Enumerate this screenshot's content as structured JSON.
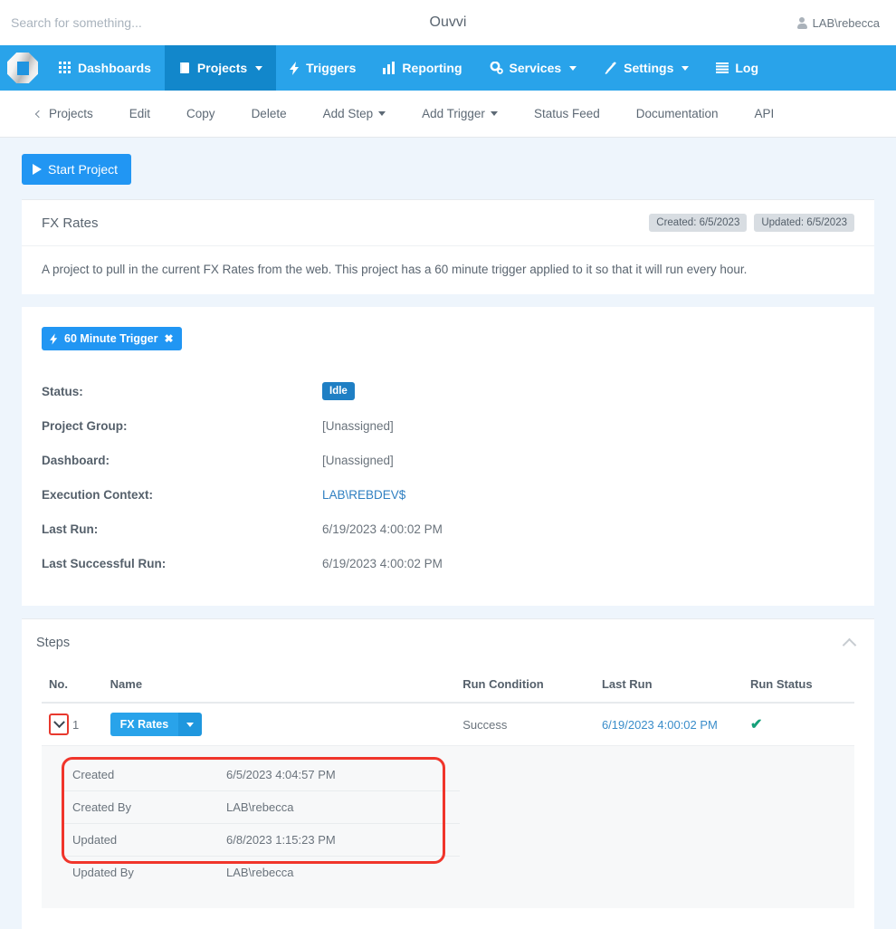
{
  "topbar": {
    "search_placeholder": "Search for something...",
    "search_value": "",
    "app_title": "Ouvvi",
    "user": "LAB\\rebecca"
  },
  "mainnav": {
    "items": [
      {
        "label": "Dashboards",
        "icon": "grid-icon",
        "caret": false,
        "active": false
      },
      {
        "label": "Projects",
        "icon": "book-icon",
        "caret": true,
        "active": true
      },
      {
        "label": "Triggers",
        "icon": "bolt-icon",
        "caret": false,
        "active": false
      },
      {
        "label": "Reporting",
        "icon": "bar-chart-icon",
        "caret": false,
        "active": false
      },
      {
        "label": "Services",
        "icon": "gears-icon",
        "caret": true,
        "active": false
      },
      {
        "label": "Settings",
        "icon": "magic-wand-icon",
        "caret": true,
        "active": false
      },
      {
        "label": "Log",
        "icon": "list-icon",
        "caret": false,
        "active": false
      }
    ]
  },
  "subnav": {
    "items": [
      {
        "label": "Projects",
        "back": true,
        "caret": false
      },
      {
        "label": "Edit",
        "back": false,
        "caret": false
      },
      {
        "label": "Copy",
        "back": false,
        "caret": false
      },
      {
        "label": "Delete",
        "back": false,
        "caret": false
      },
      {
        "label": "Add Step",
        "back": false,
        "caret": true
      },
      {
        "label": "Add Trigger",
        "back": false,
        "caret": true
      },
      {
        "label": "Status Feed",
        "back": false,
        "caret": false
      },
      {
        "label": "Documentation",
        "back": false,
        "caret": false
      },
      {
        "label": "API",
        "back": false,
        "caret": false
      }
    ]
  },
  "actions": {
    "start_project": "Start Project"
  },
  "project": {
    "title": "FX Rates",
    "created_badge": "Created: 6/5/2023",
    "updated_badge": "Updated: 6/5/2023",
    "description": "A project to pull in the current FX Rates from the web. This project has a 60 minute trigger applied to it so that it will run every hour.",
    "trigger_badge": "60 Minute Trigger",
    "trigger_remove": "✖",
    "fields": [
      {
        "key": "Status:",
        "value": "Idle",
        "type": "badge"
      },
      {
        "key": "Project Group:",
        "value": "[Unassigned]",
        "type": "text"
      },
      {
        "key": "Dashboard:",
        "value": "[Unassigned]",
        "type": "text"
      },
      {
        "key": "Execution Context:",
        "value": "LAB\\REBDEV$",
        "type": "link"
      },
      {
        "key": "Last Run:",
        "value": "6/19/2023 4:00:02 PM",
        "type": "text"
      },
      {
        "key": "Last Successful Run:",
        "value": "6/19/2023 4:00:02 PM",
        "type": "text"
      }
    ]
  },
  "steps": {
    "panel_title": "Steps",
    "columns": [
      "No.",
      "Name",
      "Run Condition",
      "Last Run",
      "Run Status"
    ],
    "rows": [
      {
        "no": "1",
        "name": "FX Rates",
        "run_condition": "Success",
        "last_run": "6/19/2023 4:00:02 PM",
        "run_status": "✔"
      }
    ],
    "expanded_details": [
      {
        "key": "Created",
        "value": "6/5/2023 4:04:57 PM"
      },
      {
        "key": "Created By",
        "value": "LAB\\rebecca"
      },
      {
        "key": "Updated",
        "value": "6/8/2023 1:15:23 PM"
      },
      {
        "key": "Updated By",
        "value": "LAB\\rebecca"
      }
    ]
  },
  "colors": {
    "nav_blue": "#29a3ea",
    "nav_active": "#1287cb",
    "button_blue": "#2196f3",
    "page_background": "#eef5fc",
    "status_badge": "#1f7fc4",
    "success_green": "#16a07a",
    "annotation_red": "#f0352b"
  }
}
